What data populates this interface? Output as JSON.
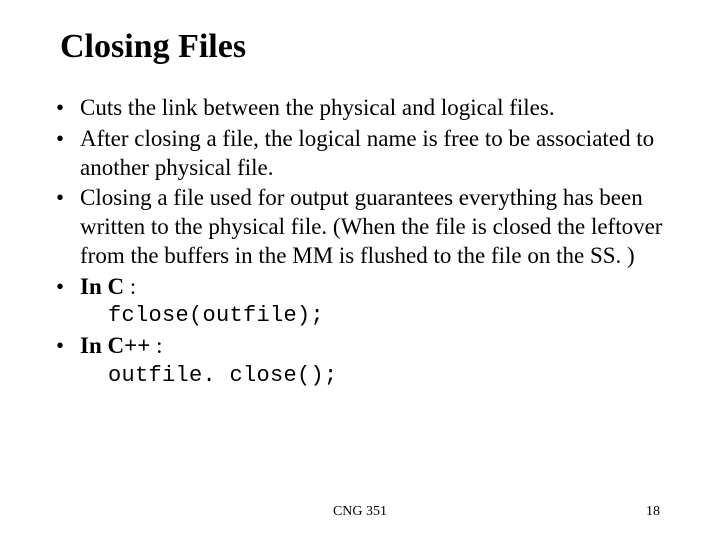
{
  "title": "Closing Files",
  "bullets": {
    "b1": "Cuts the link between the physical and logical files.",
    "b2": "After closing a file, the logical name is free to be associated to another physical file.",
    "b3": "Closing a file used for output guarantees everything has been written to the physical file. (When the file is closed the leftover from the buffers in the MM is flushed to the file on the SS. )",
    "b4_prefix": "In C",
    "b4_suffix": " :",
    "code_c": "fclose(outfile);",
    "b5_prefix": "In C++",
    "b5_suffix": " :",
    "code_cpp": "outfile. close();"
  },
  "footer": {
    "center": "CNG 351",
    "right": "18"
  }
}
